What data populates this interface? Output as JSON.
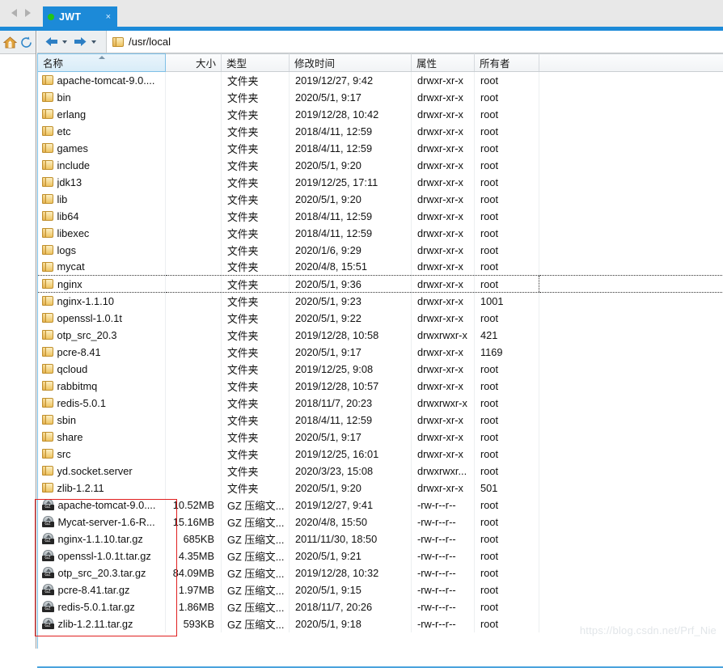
{
  "window": {
    "tab": {
      "label": "JWT",
      "status_dot_color": "#22c516",
      "close_label": "×"
    },
    "nav_prev": "prev-tab",
    "nav_next": "next-tab",
    "accent_color": "#1c8ad8"
  },
  "left_toolbar": {
    "home_icon": "home-icon",
    "refresh_icon": "refresh-icon"
  },
  "addressbar": {
    "back_label": "back",
    "forward_label": "forward",
    "path": "/usr/local"
  },
  "columns": [
    {
      "key": "name",
      "label": "名称",
      "align": "left",
      "sorted": true
    },
    {
      "key": "size",
      "label": "大小",
      "align": "right",
      "sorted": false
    },
    {
      "key": "type",
      "label": "类型",
      "align": "left",
      "sorted": false
    },
    {
      "key": "time",
      "label": "修改时间",
      "align": "left",
      "sorted": false
    },
    {
      "key": "attr",
      "label": "属性",
      "align": "left",
      "sorted": false
    },
    {
      "key": "owner",
      "label": "所有者",
      "align": "left",
      "sorted": false
    }
  ],
  "rows": [
    {
      "icon": "folder-icon",
      "name": "apache-tomcat-9.0....",
      "size": "",
      "type": "文件夹",
      "time": "2019/12/27, 9:42",
      "attr": "drwxr-xr-x",
      "owner": "root",
      "focused": false
    },
    {
      "icon": "folder-icon",
      "name": "bin",
      "size": "",
      "type": "文件夹",
      "time": "2020/5/1, 9:17",
      "attr": "drwxr-xr-x",
      "owner": "root",
      "focused": false
    },
    {
      "icon": "folder-icon",
      "name": "erlang",
      "size": "",
      "type": "文件夹",
      "time": "2019/12/28, 10:42",
      "attr": "drwxr-xr-x",
      "owner": "root",
      "focused": false
    },
    {
      "icon": "folder-icon",
      "name": "etc",
      "size": "",
      "type": "文件夹",
      "time": "2018/4/11, 12:59",
      "attr": "drwxr-xr-x",
      "owner": "root",
      "focused": false
    },
    {
      "icon": "folder-icon",
      "name": "games",
      "size": "",
      "type": "文件夹",
      "time": "2018/4/11, 12:59",
      "attr": "drwxr-xr-x",
      "owner": "root",
      "focused": false
    },
    {
      "icon": "folder-icon",
      "name": "include",
      "size": "",
      "type": "文件夹",
      "time": "2020/5/1, 9:20",
      "attr": "drwxr-xr-x",
      "owner": "root",
      "focused": false
    },
    {
      "icon": "folder-icon",
      "name": "jdk13",
      "size": "",
      "type": "文件夹",
      "time": "2019/12/25, 17:11",
      "attr": "drwxr-xr-x",
      "owner": "root",
      "focused": false
    },
    {
      "icon": "folder-icon",
      "name": "lib",
      "size": "",
      "type": "文件夹",
      "time": "2020/5/1, 9:20",
      "attr": "drwxr-xr-x",
      "owner": "root",
      "focused": false
    },
    {
      "icon": "folder-icon",
      "name": "lib64",
      "size": "",
      "type": "文件夹",
      "time": "2018/4/11, 12:59",
      "attr": "drwxr-xr-x",
      "owner": "root",
      "focused": false
    },
    {
      "icon": "folder-icon",
      "name": "libexec",
      "size": "",
      "type": "文件夹",
      "time": "2018/4/11, 12:59",
      "attr": "drwxr-xr-x",
      "owner": "root",
      "focused": false
    },
    {
      "icon": "folder-icon",
      "name": "logs",
      "size": "",
      "type": "文件夹",
      "time": "2020/1/6, 9:29",
      "attr": "drwxr-xr-x",
      "owner": "root",
      "focused": false
    },
    {
      "icon": "folder-icon",
      "name": "mycat",
      "size": "",
      "type": "文件夹",
      "time": "2020/4/8, 15:51",
      "attr": "drwxr-xr-x",
      "owner": "root",
      "focused": false
    },
    {
      "icon": "folder-icon",
      "name": "nginx",
      "size": "",
      "type": "文件夹",
      "time": "2020/5/1, 9:36",
      "attr": "drwxr-xr-x",
      "owner": "root",
      "focused": true
    },
    {
      "icon": "folder-icon",
      "name": "nginx-1.1.10",
      "size": "",
      "type": "文件夹",
      "time": "2020/5/1, 9:23",
      "attr": "drwxr-xr-x",
      "owner": "1001",
      "focused": false
    },
    {
      "icon": "folder-icon",
      "name": "openssl-1.0.1t",
      "size": "",
      "type": "文件夹",
      "time": "2020/5/1, 9:22",
      "attr": "drwxr-xr-x",
      "owner": "root",
      "focused": false
    },
    {
      "icon": "folder-icon",
      "name": "otp_src_20.3",
      "size": "",
      "type": "文件夹",
      "time": "2019/12/28, 10:58",
      "attr": "drwxrwxr-x",
      "owner": "421",
      "focused": false
    },
    {
      "icon": "folder-icon",
      "name": "pcre-8.41",
      "size": "",
      "type": "文件夹",
      "time": "2020/5/1, 9:17",
      "attr": "drwxr-xr-x",
      "owner": "1169",
      "focused": false
    },
    {
      "icon": "folder-icon",
      "name": "qcloud",
      "size": "",
      "type": "文件夹",
      "time": "2019/12/25, 9:08",
      "attr": "drwxr-xr-x",
      "owner": "root",
      "focused": false
    },
    {
      "icon": "folder-icon",
      "name": "rabbitmq",
      "size": "",
      "type": "文件夹",
      "time": "2019/12/28, 10:57",
      "attr": "drwxr-xr-x",
      "owner": "root",
      "focused": false
    },
    {
      "icon": "folder-icon",
      "name": "redis-5.0.1",
      "size": "",
      "type": "文件夹",
      "time": "2018/11/7, 20:23",
      "attr": "drwxrwxr-x",
      "owner": "root",
      "focused": false
    },
    {
      "icon": "folder-icon",
      "name": "sbin",
      "size": "",
      "type": "文件夹",
      "time": "2018/4/11, 12:59",
      "attr": "drwxr-xr-x",
      "owner": "root",
      "focused": false
    },
    {
      "icon": "folder-icon",
      "name": "share",
      "size": "",
      "type": "文件夹",
      "time": "2020/5/1, 9:17",
      "attr": "drwxr-xr-x",
      "owner": "root",
      "focused": false
    },
    {
      "icon": "folder-icon",
      "name": "src",
      "size": "",
      "type": "文件夹",
      "time": "2019/12/25, 16:01",
      "attr": "drwxr-xr-x",
      "owner": "root",
      "focused": false
    },
    {
      "icon": "folder-icon",
      "name": "yd.socket.server",
      "size": "",
      "type": "文件夹",
      "time": "2020/3/23, 15:08",
      "attr": "drwxrwxr...",
      "owner": "root",
      "focused": false
    },
    {
      "icon": "folder-icon",
      "name": "zlib-1.2.11",
      "size": "",
      "type": "文件夹",
      "time": "2020/5/1, 9:20",
      "attr": "drwxr-xr-x",
      "owner": "501",
      "focused": false
    },
    {
      "icon": "gz-archive-icon",
      "name": "apache-tomcat-9.0....",
      "size": "10.52MB",
      "type": "GZ 压缩文...",
      "time": "2019/12/27, 9:41",
      "attr": "-rw-r--r--",
      "owner": "root",
      "focused": false
    },
    {
      "icon": "gz-archive-icon",
      "name": "Mycat-server-1.6-R...",
      "size": "15.16MB",
      "type": "GZ 压缩文...",
      "time": "2020/4/8, 15:50",
      "attr": "-rw-r--r--",
      "owner": "root",
      "focused": false
    },
    {
      "icon": "gz-archive-icon",
      "name": "nginx-1.1.10.tar.gz",
      "size": "685KB",
      "type": "GZ 压缩文...",
      "time": "2011/11/30, 18:50",
      "attr": "-rw-r--r--",
      "owner": "root",
      "focused": false
    },
    {
      "icon": "gz-archive-icon",
      "name": "openssl-1.0.1t.tar.gz",
      "size": "4.35MB",
      "type": "GZ 压缩文...",
      "time": "2020/5/1, 9:21",
      "attr": "-rw-r--r--",
      "owner": "root",
      "focused": false
    },
    {
      "icon": "gz-archive-icon",
      "name": "otp_src_20.3.tar.gz",
      "size": "84.09MB",
      "type": "GZ 压缩文...",
      "time": "2019/12/28, 10:32",
      "attr": "-rw-r--r--",
      "owner": "root",
      "focused": false
    },
    {
      "icon": "gz-archive-icon",
      "name": "pcre-8.41.tar.gz",
      "size": "1.97MB",
      "type": "GZ 压缩文...",
      "time": "2020/5/1, 9:15",
      "attr": "-rw-r--r--",
      "owner": "root",
      "focused": false
    },
    {
      "icon": "gz-archive-icon",
      "name": "redis-5.0.1.tar.gz",
      "size": "1.86MB",
      "type": "GZ 压缩文...",
      "time": "2018/11/7, 20:26",
      "attr": "-rw-r--r--",
      "owner": "root",
      "focused": false
    },
    {
      "icon": "gz-archive-icon",
      "name": "zlib-1.2.11.tar.gz",
      "size": "593KB",
      "type": "GZ 压缩文...",
      "time": "2020/5/1, 9:18",
      "attr": "-rw-r--r--",
      "owner": "root",
      "focused": false
    }
  ],
  "annotation": {
    "color": "#e02020",
    "shape": "rectangle"
  },
  "watermark": {
    "text": "https://blog.csdn.net/Prf_Nie"
  },
  "gz_badge_text": "GZ"
}
